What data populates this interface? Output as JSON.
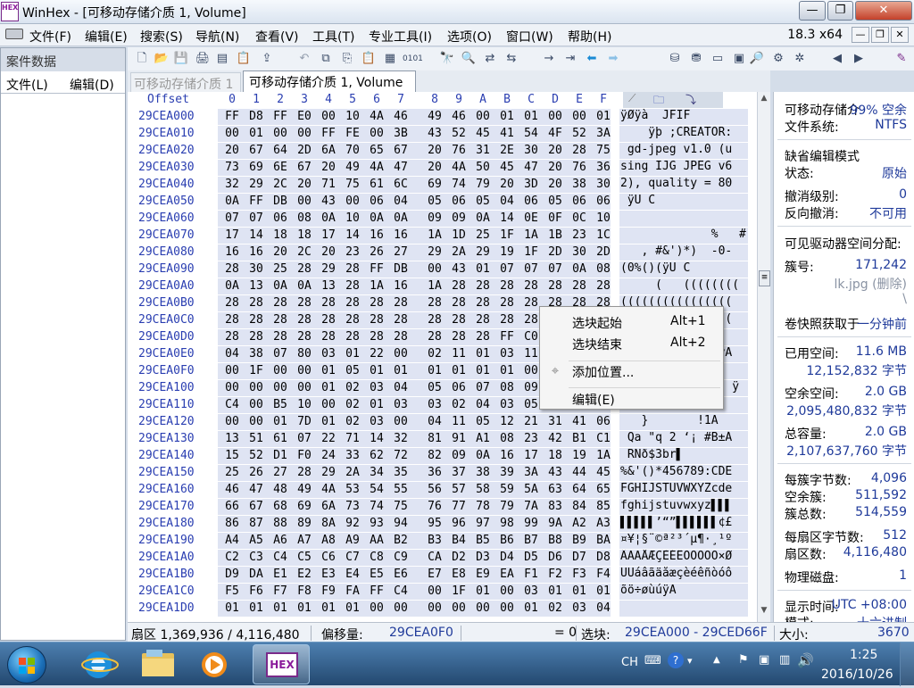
{
  "window": {
    "logo_text": "HEX",
    "title": "WinHex - [可移动存储介质 1, Volume]",
    "btn_min": "—",
    "btn_max": "❐",
    "btn_close": "✕"
  },
  "menubar": {
    "items": [
      "文件(F)",
      "编辑(E)",
      "搜索(S)",
      "导航(N)",
      "查看(V)",
      "工具(T)",
      "专业工具(I)",
      "选项(O)",
      "窗口(W)",
      "帮助(H)"
    ],
    "version": "18.3 x64"
  },
  "sidebar": {
    "title": "案件数据",
    "menu_file": "文件(L)",
    "menu_edit": "编辑(D)"
  },
  "tabs": {
    "inactive": "可移动存储介质 1",
    "active": "可移动存储介质 1, Volume"
  },
  "hex": {
    "offset_label": "Offset",
    "columns": [
      "0",
      "1",
      "2",
      "3",
      "4",
      "5",
      "6",
      "7",
      "8",
      "9",
      "A",
      "B",
      "C",
      "D",
      "E",
      "F"
    ],
    "rows": [
      {
        "off": "29CEA000",
        "b": [
          "FF",
          "D8",
          "FF",
          "E0",
          "00",
          "10",
          "4A",
          "46",
          "49",
          "46",
          "00",
          "01",
          "01",
          "00",
          "00",
          "01"
        ],
        "a": "ÿØÿà  JFIF"
      },
      {
        "off": "29CEA010",
        "b": [
          "00",
          "01",
          "00",
          "00",
          "FF",
          "FE",
          "00",
          "3B",
          "43",
          "52",
          "45",
          "41",
          "54",
          "4F",
          "52",
          "3A"
        ],
        "a": "    ÿþ ;CREATOR:"
      },
      {
        "off": "29CEA020",
        "b": [
          "20",
          "67",
          "64",
          "2D",
          "6A",
          "70",
          "65",
          "67",
          "20",
          "76",
          "31",
          "2E",
          "30",
          "20",
          "28",
          "75"
        ],
        "a": " gd-jpeg v1.0 (u"
      },
      {
        "off": "29CEA030",
        "b": [
          "73",
          "69",
          "6E",
          "67",
          "20",
          "49",
          "4A",
          "47",
          "20",
          "4A",
          "50",
          "45",
          "47",
          "20",
          "76",
          "36"
        ],
        "a": "sing IJG JPEG v6"
      },
      {
        "off": "29CEA040",
        "b": [
          "32",
          "29",
          "2C",
          "20",
          "71",
          "75",
          "61",
          "6C",
          "69",
          "74",
          "79",
          "20",
          "3D",
          "20",
          "38",
          "30"
        ],
        "a": "2), quality = 80"
      },
      {
        "off": "29CEA050",
        "b": [
          "0A",
          "FF",
          "DB",
          "00",
          "43",
          "00",
          "06",
          "04",
          "05",
          "06",
          "05",
          "04",
          "06",
          "05",
          "06",
          "06"
        ],
        "a": " ÿÛ C"
      },
      {
        "off": "29CEA060",
        "b": [
          "07",
          "07",
          "06",
          "08",
          "0A",
          "10",
          "0A",
          "0A",
          "09",
          "09",
          "0A",
          "14",
          "0E",
          "0F",
          "0C",
          "10"
        ],
        "a": ""
      },
      {
        "off": "29CEA070",
        "b": [
          "17",
          "14",
          "18",
          "18",
          "17",
          "14",
          "16",
          "16",
          "1A",
          "1D",
          "25",
          "1F",
          "1A",
          "1B",
          "23",
          "1C"
        ],
        "a": "             %   #"
      },
      {
        "off": "29CEA080",
        "b": [
          "16",
          "16",
          "20",
          "2C",
          "20",
          "23",
          "26",
          "27",
          "29",
          "2A",
          "29",
          "19",
          "1F",
          "2D",
          "30",
          "2D"
        ],
        "a": "   , #&')*)  -0-"
      },
      {
        "off": "29CEA090",
        "b": [
          "28",
          "30",
          "25",
          "28",
          "29",
          "28",
          "FF",
          "DB",
          "00",
          "43",
          "01",
          "07",
          "07",
          "07",
          "0A",
          "08"
        ],
        "a": "(0%()(ÿÛ C"
      },
      {
        "off": "29CEA0A0",
        "b": [
          "0A",
          "13",
          "0A",
          "0A",
          "13",
          "28",
          "1A",
          "16",
          "1A",
          "28",
          "28",
          "28",
          "28",
          "28",
          "28",
          "28"
        ],
        "a": "     (   (((((((("
      },
      {
        "off": "29CEA0B0",
        "b": [
          "28",
          "28",
          "28",
          "28",
          "28",
          "28",
          "28",
          "28",
          "28",
          "28",
          "28",
          "28",
          "28",
          "28",
          "28",
          "28"
        ],
        "a": "(((((((((((((((("
      },
      {
        "off": "29CEA0C0",
        "b": [
          "28",
          "28",
          "28",
          "28",
          "28",
          "28",
          "28",
          "28",
          "28",
          "28",
          "28",
          "28",
          "28",
          "28",
          "28",
          "28"
        ],
        "a": "(((((((((((((((("
      },
      {
        "off": "29CEA0D0",
        "b": [
          "28",
          "28",
          "28",
          "28",
          "28",
          "28",
          "28",
          "28",
          "28",
          "28",
          "28",
          "FF",
          "C0",
          "",
          "",
          ""
        ],
        "a": ""
      },
      {
        "off": "29CEA0E0",
        "b": [
          "04",
          "38",
          "07",
          "80",
          "03",
          "01",
          "22",
          "00",
          "02",
          "11",
          "01",
          "03",
          "11",
          "",
          "",
          ""
        ],
        "a": "              ÿÄ"
      },
      {
        "off": "29CEA0F0",
        "b": [
          "00",
          "1F",
          "00",
          "00",
          "01",
          "05",
          "01",
          "01",
          "01",
          "01",
          "01",
          "01",
          "00",
          "",
          "",
          ""
        ],
        "a": ""
      },
      {
        "off": "29CEA100",
        "b": [
          "00",
          "00",
          "00",
          "00",
          "01",
          "02",
          "03",
          "04",
          "05",
          "06",
          "07",
          "08",
          "09",
          "",
          "",
          ""
        ],
        "a": "                ÿ"
      },
      {
        "off": "29CEA110",
        "b": [
          "C4",
          "00",
          "B5",
          "10",
          "00",
          "02",
          "01",
          "03",
          "03",
          "02",
          "04",
          "03",
          "05",
          "",
          "",
          ""
        ],
        "a": ""
      },
      {
        "off": "29CEA120",
        "b": [
          "00",
          "00",
          "01",
          "7D",
          "01",
          "02",
          "03",
          "00",
          "04",
          "11",
          "05",
          "12",
          "21",
          "31",
          "41",
          "06"
        ],
        "a": "   }       !1A"
      },
      {
        "off": "29CEA130",
        "b": [
          "13",
          "51",
          "61",
          "07",
          "22",
          "71",
          "14",
          "32",
          "81",
          "91",
          "A1",
          "08",
          "23",
          "42",
          "B1",
          "C1"
        ],
        "a": " Qa \"q 2 ‘¡ #B±Á"
      },
      {
        "off": "29CEA140",
        "b": [
          "15",
          "52",
          "D1",
          "F0",
          "24",
          "33",
          "62",
          "72",
          "82",
          "09",
          "0A",
          "16",
          "17",
          "18",
          "19",
          "1A"
        ],
        "a": " RÑð$3br▌"
      },
      {
        "off": "29CEA150",
        "b": [
          "25",
          "26",
          "27",
          "28",
          "29",
          "2A",
          "34",
          "35",
          "36",
          "37",
          "38",
          "39",
          "3A",
          "43",
          "44",
          "45"
        ],
        "a": "%&'()*456789:CDE"
      },
      {
        "off": "29CEA160",
        "b": [
          "46",
          "47",
          "48",
          "49",
          "4A",
          "53",
          "54",
          "55",
          "56",
          "57",
          "58",
          "59",
          "5A",
          "63",
          "64",
          "65"
        ],
        "a": "FGHIJSTUVWXYZcde"
      },
      {
        "off": "29CEA170",
        "b": [
          "66",
          "67",
          "68",
          "69",
          "6A",
          "73",
          "74",
          "75",
          "76",
          "77",
          "78",
          "79",
          "7A",
          "83",
          "84",
          "85"
        ],
        "a": "fghijstuvwxyz▌▌▌"
      },
      {
        "off": "29CEA180",
        "b": [
          "86",
          "87",
          "88",
          "89",
          "8A",
          "92",
          "93",
          "94",
          "95",
          "96",
          "97",
          "98",
          "99",
          "9A",
          "A2",
          "A3"
        ],
        "a": "▌▌▌▌▌’“”▌▌▌▌▌▌¢£"
      },
      {
        "off": "29CEA190",
        "b": [
          "A4",
          "A5",
          "A6",
          "A7",
          "A8",
          "A9",
          "AA",
          "B2",
          "B3",
          "B4",
          "B5",
          "B6",
          "B7",
          "B8",
          "B9",
          "BA"
        ],
        "a": "¤¥¦§¨©ª²³´µ¶·¸¹º"
      },
      {
        "off": "29CEA1A0",
        "b": [
          "C2",
          "C3",
          "C4",
          "C5",
          "C6",
          "C7",
          "C8",
          "C9",
          "CA",
          "D2",
          "D3",
          "D4",
          "D5",
          "D6",
          "D7",
          "D8"
        ],
        "a": "ÂÃÄÅÆÇÈÉÊÒÓÔÕÖ×Ø"
      },
      {
        "off": "29CEA1B0",
        "b": [
          "D9",
          "DA",
          "E1",
          "E2",
          "E3",
          "E4",
          "E5",
          "E6",
          "E7",
          "E8",
          "E9",
          "EA",
          "F1",
          "F2",
          "F3",
          "F4"
        ],
        "a": "ÙÚáâãäåæçèéêñòóô"
      },
      {
        "off": "29CEA1C0",
        "b": [
          "F5",
          "F6",
          "F7",
          "F8",
          "F9",
          "FA",
          "FF",
          "C4",
          "00",
          "1F",
          "01",
          "00",
          "03",
          "01",
          "01",
          "01"
        ],
        "a": "õö÷øùúÿÄ"
      },
      {
        "off": "29CEA1D0",
        "b": [
          "01",
          "01",
          "01",
          "01",
          "01",
          "01",
          "00",
          "00",
          "00",
          "00",
          "00",
          "00",
          "01",
          "02",
          "03",
          "04"
        ],
        "a": ""
      }
    ]
  },
  "context_menu": {
    "items": [
      {
        "label": "选块起始",
        "key": "Alt+1"
      },
      {
        "label": "选块结束",
        "key": "Alt+2"
      },
      {
        "label": "添加位置...",
        "key": ""
      },
      {
        "label": "编辑(E)",
        "key": ""
      }
    ]
  },
  "info": {
    "l1": "可移动存储介",
    "v1": "99% 空余",
    "l2": "文件系统:",
    "v2": "NTFS",
    "l3": "缺省编辑模式",
    "l4": "状态:",
    "v4": "原始",
    "l5": "撤消级别:",
    "v5": "0",
    "l6": "反向撤消:",
    "v6": "不可用",
    "l7": "可见驱动器空间分配:",
    "l8": "簇号:",
    "v8": "171,242",
    "v9": "lk.jpg (删除)",
    "v9b": "\\",
    "l10": "卷快照获取于",
    "v10": "一分钟前",
    "l11": "已用空间:",
    "v11": "11.6 MB",
    "v11b": "12,152,832 字节",
    "l12": "空余空间:",
    "v12": "2.0 GB",
    "v12b": "2,095,480,832 字节",
    "l13": "总容量:",
    "v13": "2.0 GB",
    "v13b": "2,107,637,760 字节",
    "l14": "每簇字节数:",
    "v14": "4,096",
    "l15": "空余簇:",
    "v15": "511,592",
    "l16": "簇总数:",
    "v16": "514,559",
    "l17": "每扇区字节数:",
    "v17": "512",
    "l18": "扇区数:",
    "v18": "4,116,480",
    "l19": "物理磁盘:",
    "v19": "1",
    "l20": "显示时间:",
    "v20": "UTC +08:00",
    "l21": "模式:",
    "v21": "十六进制"
  },
  "status": {
    "sector": "扇区 1,369,936 / 4,116,480",
    "offset_label": "偏移量:",
    "offset_value": "29CEA0F0",
    "eq_value": "= 0",
    "sel_label": "选块:",
    "sel_value": "29CEA000 - 29CED66F",
    "size_label": "大小:",
    "size_value": "3670"
  },
  "taskbar": {
    "tray_lang": "CH",
    "clock_time": "1:25",
    "clock_date": "2016/10/26",
    "hex_app_label": "HEX"
  },
  "colors": {
    "accent_blue": "#1f3a9a",
    "hex_bg": "#dfe4f3",
    "offset_color": "#2a3eb1"
  }
}
